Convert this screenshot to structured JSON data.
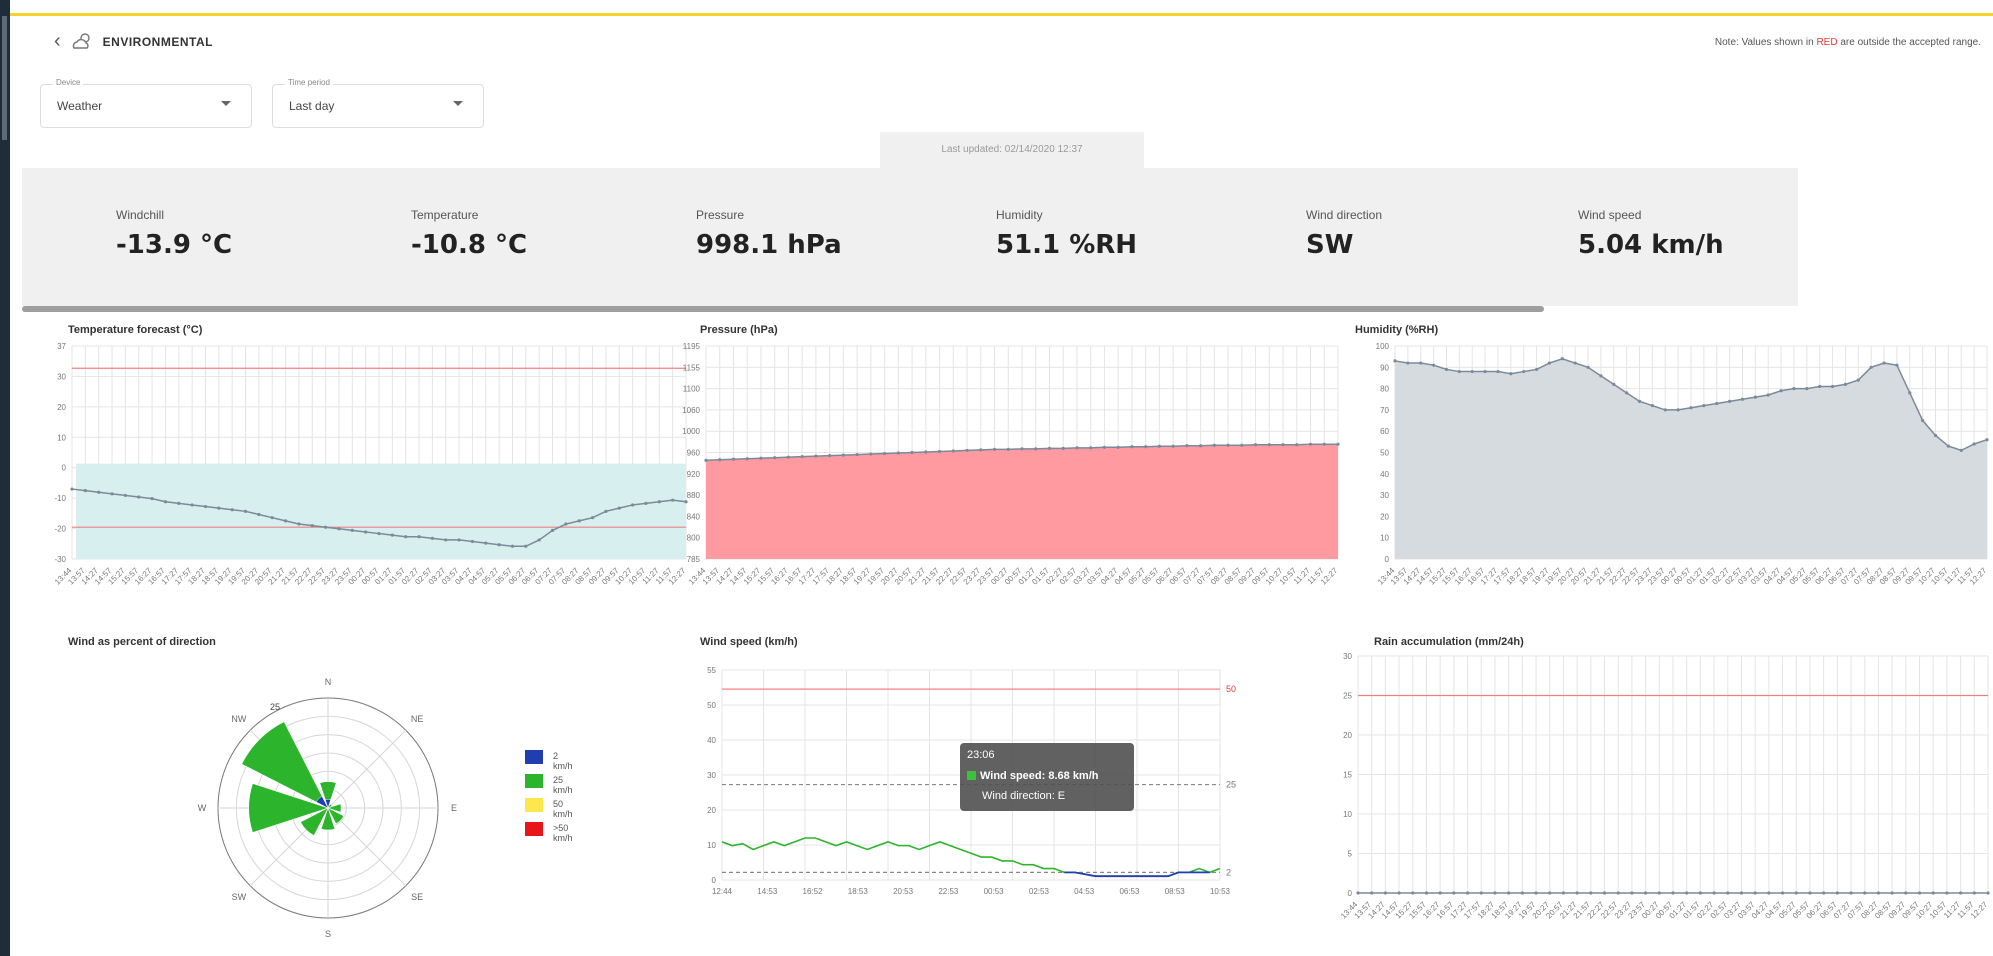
{
  "page": {
    "title": "ENVIRONMENTAL",
    "note_prefix": "Note: Values shown in ",
    "note_red": "RED",
    "note_suffix": " are outside the accepted range.",
    "back_icon": "chevron-left-icon",
    "title_icon": "cloud-sun-icon"
  },
  "filters": {
    "device": {
      "label": "Device",
      "value": "Weather"
    },
    "time_period": {
      "label": "Time period",
      "value": "Last day"
    }
  },
  "last_updated": "Last updated: 02/14/2020 12:37",
  "stats": [
    {
      "name": "Windchill",
      "value": "-13.9 °C"
    },
    {
      "name": "Temperature",
      "value": "-10.8 °C"
    },
    {
      "name": "Pressure",
      "value": "998.1 hPa"
    },
    {
      "name": "Humidity",
      "value": "51.1 %RH"
    },
    {
      "name": "Wind direction",
      "value": "SW"
    },
    {
      "name": "Wind speed",
      "value": "5.04 km/h"
    }
  ],
  "colors": {
    "accent_yellow": "#f2d22b",
    "threshold_red": "#f08080",
    "temp_fill": "#d7efee",
    "pressure_fill": "#ff9aa0",
    "humidity_fill": "#d6dbe0",
    "line_dots": "#7b8a9a",
    "wind_green": "#2cb52c",
    "wind_blue": "#1f3fb0",
    "wind_yellow": "#fde74c",
    "wind_red": "#e8151a"
  },
  "tooltip": {
    "time": "23:06",
    "speed": "Wind speed: 8.68 km/h",
    "direction": "Wind direction: E"
  },
  "chart_data": [
    {
      "type": "area",
      "title": "Temperature forecast (°C)",
      "y_ticks": [
        "37",
        "30",
        "20",
        "10",
        "0",
        "-10",
        "-20",
        "-30"
      ],
      "y_min": -30,
      "y_max": 37,
      "thresholds": [
        30,
        -20
      ],
      "x_ticks": [
        "13:44",
        "13:57",
        "14:27",
        "14:57",
        "15:27",
        "15:57",
        "16:27",
        "16:57",
        "17:27",
        "17:57",
        "18:27",
        "18:57",
        "19:27",
        "19:57",
        "20:27",
        "20:57",
        "21:27",
        "21:57",
        "22:27",
        "22:57",
        "23:27",
        "23:57",
        "00:27",
        "00:57",
        "01:27",
        "01:57",
        "02:27",
        "02:57",
        "03:27",
        "03:57",
        "04:27",
        "04:57",
        "05:27",
        "05:57",
        "06:27",
        "06:57",
        "07:27",
        "07:57",
        "08:27",
        "08:57",
        "09:27",
        "09:57",
        "10:27",
        "10:57",
        "11:27",
        "11:57",
        "12:27"
      ],
      "series": [
        {
          "values": [
            -8,
            -8.5,
            -9,
            -9.5,
            -10,
            -10.5,
            -11,
            -12,
            -12.5,
            -13,
            -13.5,
            -14,
            -14.5,
            -15,
            -16,
            -17,
            -18,
            -19,
            -19.5,
            -20,
            -20.5,
            -21,
            -21.5,
            -22,
            -22.5,
            -23,
            -23,
            -23.5,
            -24,
            -24,
            -24.5,
            -25,
            -25.5,
            -26,
            -26,
            -24,
            -21,
            -19,
            -18,
            -17,
            -15,
            -14,
            -13,
            -12.5,
            -12,
            -11.5,
            -12
          ]
        }
      ],
      "band": [
        -30,
        0
      ]
    },
    {
      "type": "area",
      "title": "Pressure (hPa)",
      "y_ticks": [
        "1195",
        "1155",
        "1100",
        "1060",
        "1000",
        "960",
        "920",
        "880",
        "840",
        "800",
        "785"
      ],
      "y_min": 785,
      "y_max": 1195,
      "series": [
        {
          "values": [
            975,
            976,
            977,
            978,
            979,
            980,
            981,
            982,
            983,
            984,
            985,
            986,
            987,
            988,
            989,
            990,
            991,
            992,
            993,
            994,
            995,
            996,
            996,
            997,
            997,
            998,
            998,
            999,
            999,
            1000,
            1000,
            1001,
            1001,
            1002,
            1002,
            1003,
            1003,
            1004,
            1004,
            1004,
            1005,
            1005,
            1005,
            1005,
            1006,
            1006,
            1006
          ]
        }
      ]
    },
    {
      "type": "area",
      "title": "Humidity (%RH)",
      "y_ticks": [
        "100",
        "90",
        "80",
        "70",
        "60",
        "50",
        "40",
        "30",
        "20",
        "10",
        "0"
      ],
      "y_min": 0,
      "y_max": 100,
      "series": [
        {
          "values": [
            93,
            92,
            92,
            91,
            89,
            88,
            88,
            88,
            88,
            87,
            88,
            89,
            92,
            94,
            92,
            90,
            86,
            82,
            78,
            74,
            72,
            70,
            70,
            71,
            72,
            73,
            74,
            75,
            76,
            77,
            79,
            80,
            80,
            81,
            81,
            82,
            84,
            90,
            92,
            91,
            78,
            65,
            58,
            53,
            51,
            54,
            56
          ]
        }
      ]
    },
    {
      "type": "pie",
      "subtype": "polar-wind-rose",
      "title": "Wind as percent of direction",
      "directions": [
        "N",
        "NE",
        "E",
        "SE",
        "S",
        "SW",
        "W",
        "NW"
      ],
      "radial_max": 25,
      "radial_label": "25",
      "legend": [
        "2 km/h",
        "25 km/h",
        "50 km/h",
        ">50 km/h"
      ],
      "series": [
        {
          "name": "2 km/h",
          "values": [
            2,
            0,
            0,
            0,
            0,
            0,
            0,
            3
          ]
        },
        {
          "name": "25 km/h",
          "values": [
            6,
            1,
            3,
            4,
            5,
            7,
            18,
            22
          ]
        },
        {
          "name": "50 km/h",
          "values": [
            0,
            0,
            0,
            0,
            0,
            0,
            0,
            0
          ]
        },
        {
          "name": ">50 km/h",
          "values": [
            0,
            0,
            0,
            0,
            0,
            0,
            0,
            0
          ]
        }
      ]
    },
    {
      "type": "line",
      "title": "Wind speed (km/h)",
      "y_ticks": [
        "55",
        "50",
        "40",
        "30",
        "20",
        "10",
        "0"
      ],
      "y_min": 0,
      "y_max": 55,
      "thresholds": [
        50,
        25,
        2
      ],
      "threshold_labels": [
        "50",
        "25",
        "2"
      ],
      "x_ticks": [
        "12:44",
        "14:53",
        "16:52",
        "18:53",
        "20:53",
        "22:53",
        "00:53",
        "02:53",
        "04:53",
        "06:53",
        "08:53",
        "10:53"
      ],
      "series": [
        {
          "values": [
            10,
            9,
            9.5,
            8,
            9,
            10,
            9,
            10,
            11,
            11,
            10,
            9,
            10,
            9,
            8,
            9,
            10,
            9,
            9,
            8,
            9,
            10,
            9,
            8,
            7,
            6,
            6,
            5,
            5,
            4,
            4,
            3,
            3,
            2,
            2,
            1.5,
            1,
            1,
            1,
            1,
            1,
            1,
            1,
            1,
            2,
            2,
            3,
            2,
            3
          ]
        }
      ]
    },
    {
      "type": "line",
      "title": "Rain accumulation (mm/24h)",
      "y_ticks": [
        "30",
        "25",
        "20",
        "15",
        "10",
        "5",
        "0"
      ],
      "y_min": 0,
      "y_max": 30,
      "thresholds": [
        25
      ],
      "series": [
        {
          "values": [
            0,
            0,
            0,
            0,
            0,
            0,
            0,
            0,
            0,
            0,
            0,
            0,
            0,
            0,
            0,
            0,
            0,
            0,
            0,
            0,
            0,
            0,
            0,
            0,
            0,
            0,
            0,
            0,
            0,
            0,
            0,
            0,
            0,
            0,
            0,
            0,
            0,
            0,
            0,
            0,
            0,
            0,
            0,
            0,
            0,
            0,
            0
          ]
        }
      ]
    }
  ]
}
